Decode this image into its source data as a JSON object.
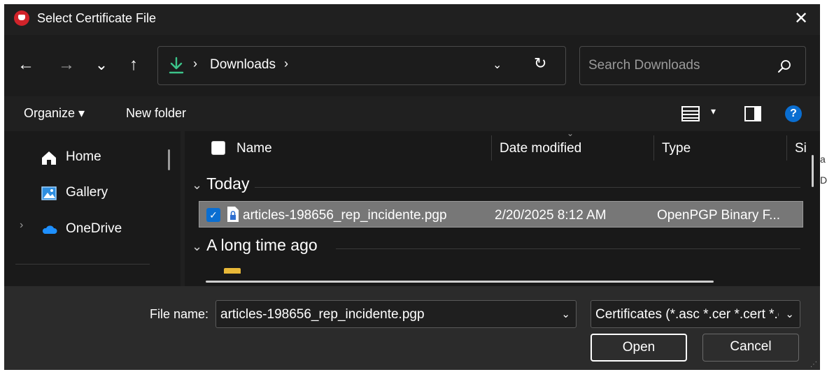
{
  "window": {
    "title": "Select Certificate File",
    "close_label": "✕"
  },
  "nav": {
    "back": "←",
    "forward": "→",
    "recent": "⌄",
    "up": "↑",
    "address_chevron": "›",
    "address_path": "Downloads",
    "address_dropdown": "⌄",
    "refresh": "↻",
    "search_placeholder": "Search Downloads"
  },
  "commands": {
    "organize": "Organize ▾",
    "new_folder": "New folder",
    "view_dropdown": "▾",
    "help": "?"
  },
  "sidebar": {
    "items": [
      {
        "label": "Home",
        "icon": "home-icon"
      },
      {
        "label": "Gallery",
        "icon": "gallery-icon"
      },
      {
        "label": "OneDrive",
        "icon": "onedrive-icon"
      }
    ],
    "expand_glyph": "›"
  },
  "filelist": {
    "columns": [
      "Name",
      "Date modified",
      "Type",
      "Si"
    ],
    "groups": [
      {
        "title": "Today",
        "files": [
          {
            "name": "articles-198656_rep_incidente.pgp",
            "date": "2/20/2025 8:12 AM",
            "type": "OpenPGP Binary F...",
            "selected": true
          }
        ]
      },
      {
        "title": "A long time ago",
        "files": []
      }
    ],
    "group_chevron": "⌄",
    "check_glyph": "✓",
    "sort_caret": "⌄"
  },
  "bottom": {
    "file_name_label": "File name:",
    "file_name_value": "articles-198656_rep_incidente.pgp",
    "filter_value": "Certificates (*.asc *.cer *.cert *.c",
    "dropdown_glyph": "⌄",
    "open_label": "Open",
    "cancel_label": "Cancel",
    "grip": "⋰"
  },
  "background": {
    "peek_1": "a",
    "peek_2": "D/"
  },
  "colors": {
    "dialog_bg": "#202020",
    "selection": "#777777",
    "accent": "#0a6ed1",
    "download_icon": "#3cc48a",
    "folder": "#e8b838",
    "onedrive": "#1e90ff"
  }
}
